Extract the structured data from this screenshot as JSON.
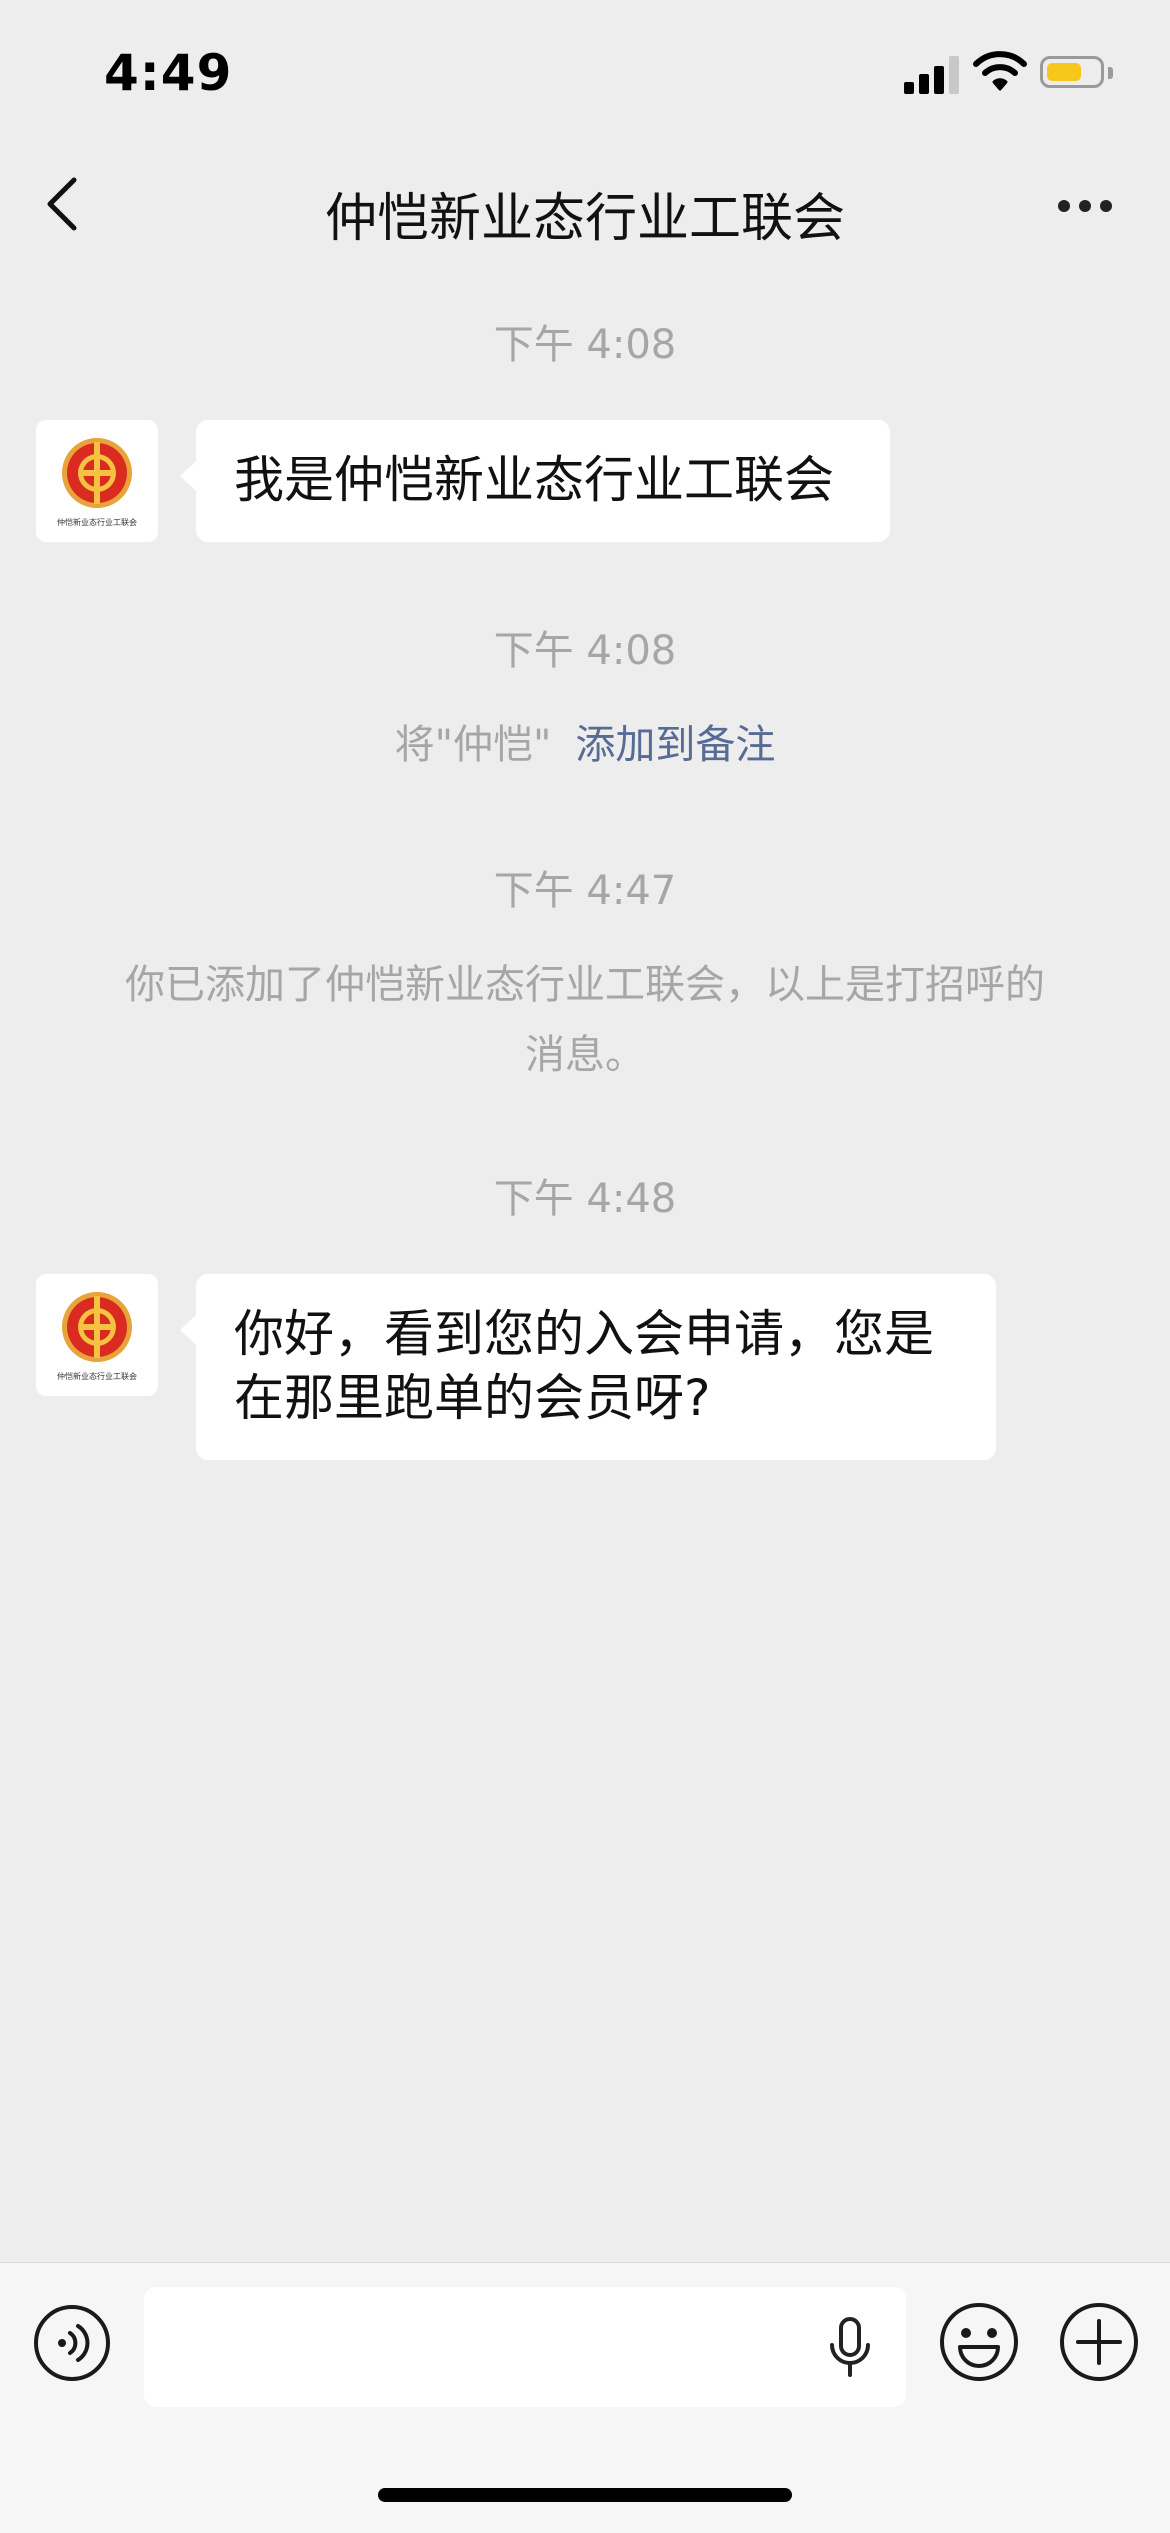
{
  "status_bar": {
    "time": "4:49",
    "battery_color": "#f7c81b",
    "icons": [
      "signal-icon",
      "wifi-icon",
      "battery-icon"
    ]
  },
  "nav": {
    "title": "仲恺新业态行业工联会",
    "back_icon": "chevron-left-icon",
    "more_icon": "more-dots-icon"
  },
  "chat": {
    "timestamps": [
      "下午 4:08",
      "下午 4:08",
      "下午 4:47",
      "下午 4:48"
    ],
    "messages": [
      {
        "sender": "仲恺新业态行业工联会",
        "text_lines": [
          "我是仲恺新业态行业工联会"
        ]
      },
      {
        "sender": "仲恺新业态行业工联会",
        "text_lines": [
          "你好，看到您的入会申请，您是",
          "在那里跑单的会员呀?"
        ]
      }
    ],
    "remark_prompt": {
      "text": "将\"仲恺\"",
      "link": "添加到备注"
    },
    "added_notice_lines": [
      "你已添加了仲恺新业态行业工联会，以上是打招呼的",
      "消息。"
    ],
    "avatar_caption": "仲恺新业态行业工联会",
    "link_color": "#576b95"
  },
  "input_bar": {
    "placeholder": "",
    "left_icon": "voice-icon",
    "right_icons": [
      "mic-icon",
      "emoji-icon",
      "plus-icon"
    ]
  }
}
